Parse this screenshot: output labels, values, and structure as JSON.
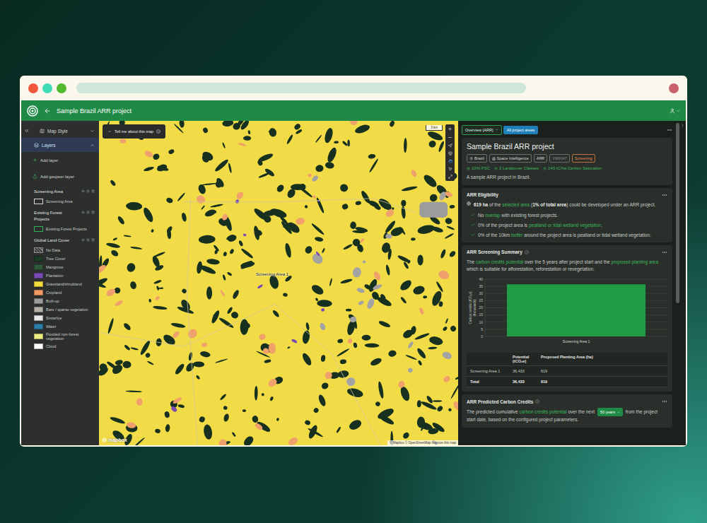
{
  "header": {
    "title": "Sample Brazil ARR project"
  },
  "sidebar": {
    "map_style": {
      "label": "Map Style",
      "expanded": false
    },
    "layers": {
      "label": "Layers",
      "expanded": true,
      "selected": true
    },
    "add_layer": "Add layer",
    "add_geojson": "Add geojson layer",
    "groups": [
      {
        "title": "Screening Area",
        "items": [
          {
            "label": "Screening Area",
            "kind": "outline",
            "color": "#d9d9d9"
          }
        ]
      },
      {
        "title": "Existing Forest Projects",
        "items": [
          {
            "label": "Existing Forest Projects",
            "kind": "outline",
            "color": "#2eb35a"
          }
        ]
      },
      {
        "title": "Global Land Cover",
        "items": [
          {
            "label": "No Data",
            "kind": "hatch",
            "color": "#8a8a8a"
          },
          {
            "label": "Tree Cover",
            "kind": "fill",
            "color": "#1d3a26"
          },
          {
            "label": "Mangrove",
            "kind": "fill",
            "color": "#2e5a3a"
          },
          {
            "label": "Plantation",
            "kind": "fill",
            "color": "#7a4bb5"
          },
          {
            "label": "Grassland/shrubland",
            "kind": "fill",
            "color": "#f4dc3c"
          },
          {
            "label": "Cropland",
            "kind": "fill",
            "color": "#f29a62"
          },
          {
            "label": "Built-up",
            "kind": "fill",
            "color": "#9a9a9a"
          },
          {
            "label": "Bare / sparse vegetation",
            "kind": "fill",
            "color": "#b5b1a8"
          },
          {
            "label": "Snow/ice",
            "kind": "fill",
            "color": "#e6e6e6"
          },
          {
            "label": "Water",
            "kind": "fill",
            "color": "#2b7fa8"
          },
          {
            "label": "Flooded non-forest vegetation",
            "kind": "fill",
            "color": "#ecec84"
          },
          {
            "label": "Cloud",
            "kind": "fill",
            "color": "#ffffff"
          }
        ]
      }
    ]
  },
  "map": {
    "tell_me": "Tell me about this map",
    "scale": "3 km",
    "label": "Screening Area 1",
    "logo": "mapbox",
    "attribution": "© Mapbox © OpenStreetMap Improve this map"
  },
  "panel": {
    "view_select": "Overview (ARR)",
    "view_chip": "All project areas",
    "project": {
      "title": "Sample Brazil ARR project",
      "tags": [
        {
          "label": "Brazil",
          "kind": "location"
        },
        {
          "label": "Space Intelligence",
          "kind": "organisation"
        },
        {
          "label": "ARR",
          "kind": "plain"
        },
        {
          "label": "VM0047",
          "kind": "muted"
        },
        {
          "label": "Screening",
          "kind": "status"
        }
      ],
      "stats": [
        "10% PSC",
        "2 Landcover Classes",
        "143 tC/ha Carbon Saturation"
      ],
      "description": "A sample ARR project in Brazil."
    },
    "eligibility": {
      "title": "ARR Eligibility",
      "summary": [
        {
          "text": "619 ha",
          "kind": "bold"
        },
        {
          "text": " of the ",
          "kind": "plain"
        },
        {
          "text": "selected area",
          "kind": "link"
        },
        {
          "text": " (",
          "kind": "plain"
        },
        {
          "text": "1% of total area",
          "kind": "bold"
        },
        {
          "text": ") could be developed under an ARR project.",
          "kind": "plain"
        }
      ],
      "checks": [
        {
          "checked": true,
          "segments": [
            {
              "text": "No ",
              "kind": "plain"
            },
            {
              "text": "overlap",
              "kind": "link"
            },
            {
              "text": " with existing forest projects.",
              "kind": "plain"
            }
          ]
        },
        {
          "checked": true,
          "segments": [
            {
              "text": "0% of the project area is ",
              "kind": "plain"
            },
            {
              "text": "peatland or tidal wetland vegetation",
              "kind": "link"
            },
            {
              "text": ".",
              "kind": "plain"
            }
          ]
        },
        {
          "checked": true,
          "segments": [
            {
              "text": "0% of the 10km ",
              "kind": "plain"
            },
            {
              "text": "buffer",
              "kind": "link"
            },
            {
              "text": " around the project area is peatland or tidal wetland vegetation.",
              "kind": "plain"
            }
          ]
        }
      ]
    },
    "summary": {
      "title": "ARR Screening Summary",
      "text": [
        {
          "text": "The ",
          "kind": "plain"
        },
        {
          "text": "carbon credits potential",
          "kind": "link"
        },
        {
          "text": " over the 5 years after project start and the ",
          "kind": "plain"
        },
        {
          "text": "proposed planting area",
          "kind": "link"
        },
        {
          "text": " which is suitable for afforestation, reforestation or revegetation.",
          "kind": "plain"
        }
      ],
      "chart": {
        "y_label": [
          "Carbon credits (tCO₂e)",
          "(thousands)"
        ],
        "ticks": [
          "0",
          "5",
          "10",
          "15",
          "20",
          "25",
          "30",
          "35",
          "40"
        ],
        "categories": [
          "Screening Area 1"
        ],
        "values": [
          36.433
        ]
      },
      "table": {
        "columns": [
          "",
          "Potential (tCO₂e)",
          "Proposed Planting Area (ha)"
        ],
        "rows": [
          [
            "Screening Area 1",
            "36,433",
            "619"
          ]
        ],
        "total": [
          "Total",
          "36,433",
          "619"
        ]
      }
    },
    "predicted": {
      "title": "ARR Predicted Carbon Credits",
      "before": [
        {
          "text": "The predicted cumulative ",
          "kind": "plain"
        },
        {
          "text": "carbon credits potential",
          "kind": "link"
        },
        {
          "text": " over the next ",
          "kind": "plain"
        }
      ],
      "select": "50 years",
      "after": [
        {
          "text": " from the project start date, based on the configured project parameters.",
          "kind": "plain"
        }
      ]
    }
  }
}
